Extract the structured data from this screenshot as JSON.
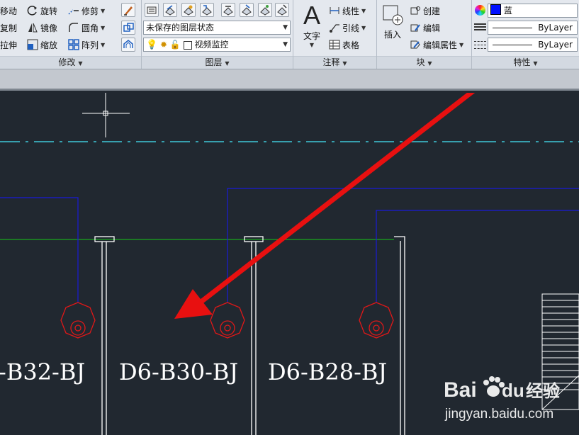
{
  "ribbon": {
    "modify": {
      "title": "修改",
      "row1": [
        "移动",
        "旋转",
        "修剪"
      ],
      "row2": [
        "复制",
        "镜像",
        "圆角"
      ],
      "row3": [
        "拉伸",
        "缩放",
        "阵列"
      ]
    },
    "layers": {
      "title": "图层",
      "state_combo": "未保存的图层状态",
      "layer_combo": "视频监控"
    },
    "annotation": {
      "title": "注释",
      "text_label": "文字",
      "linear_label": "线性",
      "leader_label": "引线",
      "table_label": "表格"
    },
    "block": {
      "title": "块",
      "insert_label": "插入",
      "create_label": "创建",
      "edit_label": "编辑",
      "edit_attr_label": "编辑属性"
    },
    "properties": {
      "title": "特性",
      "color_value": "蓝",
      "linetype_value": "ByLayer",
      "lineweight_value": "ByLayer"
    }
  },
  "drawing": {
    "labels": [
      "-B32-BJ",
      "D6-B30-BJ",
      "D6-B28-BJ"
    ],
    "colors": {
      "background": "#212830",
      "blue_line": "#1a1ad8",
      "green_line": "#18c818",
      "cyan_centerline": "#3fc8d8",
      "red_circle": "#e01818",
      "arrow": "#e81010",
      "white": "#ffffff"
    }
  },
  "watermark": {
    "brand_bai": "Bai",
    "brand_du": "du",
    "brand_cn": "经验",
    "url": "jingyan.baidu.com"
  }
}
